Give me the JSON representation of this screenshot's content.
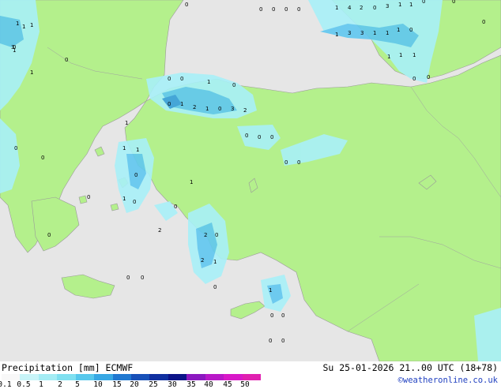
{
  "footer": {
    "title": "Precipitation [mm] ECMWF",
    "validity": "Su 25-01-2026 21..00 UTC (18+78)",
    "credit": "©weatheronline.co.uk"
  },
  "legend": {
    "ticks": [
      "0.1",
      "0.5",
      "1",
      "2",
      "5",
      "10",
      "15",
      "20",
      "25",
      "30",
      "35",
      "40",
      "45",
      "50"
    ],
    "colors": [
      "#f8f8f8",
      "#c8f4f8",
      "#a4ecf4",
      "#80e0f0",
      "#58c8ec",
      "#38a8e4",
      "#2078d0",
      "#1850b8",
      "#1030a0",
      "#0c1488",
      "#8c18c0",
      "#b818c8",
      "#d818c8",
      "#e020b0"
    ]
  },
  "map": {
    "colors": {
      "land": "#b4f08c",
      "sea": "#e6e6e6",
      "precip_light": "#a8f0f8",
      "precip_mid": "#60c8f0",
      "precip_heavy": "#3a9ee0",
      "coast": "#9a9a9a"
    },
    "point_values": [
      {
        "id": "p1",
        "text": "0"
      },
      {
        "id": "p2",
        "text": "0"
      },
      {
        "id": "p3",
        "text": "0"
      },
      {
        "id": "p4",
        "text": "0"
      },
      {
        "id": "p5",
        "text": "0"
      },
      {
        "id": "p6",
        "text": "1"
      },
      {
        "id": "p7",
        "text": "4"
      },
      {
        "id": "p8",
        "text": "2"
      },
      {
        "id": "p9",
        "text": "0"
      },
      {
        "id": "p10",
        "text": "3"
      },
      {
        "id": "p11",
        "text": "1"
      },
      {
        "id": "p12",
        "text": "1"
      },
      {
        "id": "p13",
        "text": "0"
      },
      {
        "id": "p14",
        "text": "0"
      },
      {
        "id": "p15",
        "text": "1"
      },
      {
        "id": "p16",
        "text": "1"
      },
      {
        "id": "p17",
        "text": "1"
      },
      {
        "id": "p18",
        "text": "1"
      },
      {
        "id": "p19",
        "text": "3"
      },
      {
        "id": "p20",
        "text": "3"
      },
      {
        "id": "p21",
        "text": "1"
      },
      {
        "id": "p22",
        "text": "1"
      },
      {
        "id": "p23",
        "text": "1"
      },
      {
        "id": "p24",
        "text": "0"
      },
      {
        "id": "p25",
        "text": "0"
      },
      {
        "id": "p26",
        "text": "1"
      },
      {
        "id": "p27",
        "text": "0"
      },
      {
        "id": "p28",
        "text": "1"
      },
      {
        "id": "p29",
        "text": "1"
      },
      {
        "id": "p30",
        "text": "1"
      },
      {
        "id": "p31",
        "text": "1"
      },
      {
        "id": "p32",
        "text": "3"
      },
      {
        "id": "p33",
        "text": "0"
      },
      {
        "id": "p34",
        "text": "0"
      },
      {
        "id": "p35",
        "text": "1"
      },
      {
        "id": "p36",
        "text": "0"
      },
      {
        "id": "p37",
        "text": "0"
      },
      {
        "id": "p38",
        "text": "1"
      },
      {
        "id": "p39",
        "text": "2"
      },
      {
        "id": "p40",
        "text": "1"
      },
      {
        "id": "p41",
        "text": "0"
      },
      {
        "id": "p42",
        "text": "3"
      },
      {
        "id": "p43",
        "text": "2"
      },
      {
        "id": "p44",
        "text": "1"
      },
      {
        "id": "p45",
        "text": "0"
      },
      {
        "id": "p46",
        "text": "0"
      },
      {
        "id": "p47",
        "text": "0"
      },
      {
        "id": "p48",
        "text": "1"
      },
      {
        "id": "p49",
        "text": "1"
      },
      {
        "id": "p50",
        "text": "0"
      },
      {
        "id": "p51",
        "text": "0"
      },
      {
        "id": "p52",
        "text": "0"
      },
      {
        "id": "p53",
        "text": "0"
      },
      {
        "id": "p54",
        "text": "0"
      },
      {
        "id": "p55",
        "text": "1"
      },
      {
        "id": "p56",
        "text": "1"
      },
      {
        "id": "p57",
        "text": "0"
      },
      {
        "id": "p58",
        "text": "0"
      },
      {
        "id": "p59",
        "text": "2"
      },
      {
        "id": "p60",
        "text": "2"
      },
      {
        "id": "p61",
        "text": "0"
      },
      {
        "id": "p62",
        "text": "0"
      },
      {
        "id": "p63",
        "text": "2"
      },
      {
        "id": "p64",
        "text": "1"
      },
      {
        "id": "p65",
        "text": "0"
      },
      {
        "id": "p66",
        "text": "0"
      },
      {
        "id": "p67",
        "text": "1"
      },
      {
        "id": "p68",
        "text": "0"
      },
      {
        "id": "p69",
        "text": "0"
      },
      {
        "id": "p70",
        "text": "0"
      },
      {
        "id": "p71",
        "text": "0"
      },
      {
        "id": "p72",
        "text": "0"
      },
      {
        "id": "p73",
        "text": "0"
      },
      {
        "id": "p74",
        "text": "0"
      },
      {
        "id": "p75",
        "text": "0"
      },
      {
        "id": "p76",
        "text": "0"
      }
    ]
  }
}
